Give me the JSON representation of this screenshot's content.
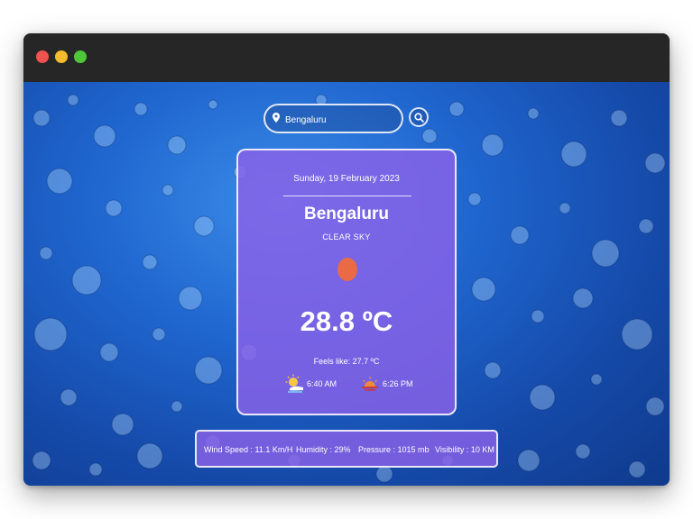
{
  "search": {
    "value": "Bengaluru",
    "icons": [
      "map-pin-icon",
      "search-icon"
    ]
  },
  "weather": {
    "date": "Sunday, 19 February 2023",
    "city": "Bengaluru",
    "condition": "CLEAR SKY",
    "temperature": "28.8 ºC",
    "feels_like": "Feels like: 27.7 ºC",
    "sunrise": "6:40 AM",
    "sunset": "6:26 PM"
  },
  "stats": {
    "wind": "Wind Speed : 11.1 Km/H",
    "humidity": "Humidity : 29%",
    "pressure": "Pressure : 1015 mb",
    "visibility": "Visibility : 10 KM"
  },
  "colors": {
    "card": "#8a62e8",
    "sun": "#e96a45",
    "background": "#1f66cf"
  }
}
